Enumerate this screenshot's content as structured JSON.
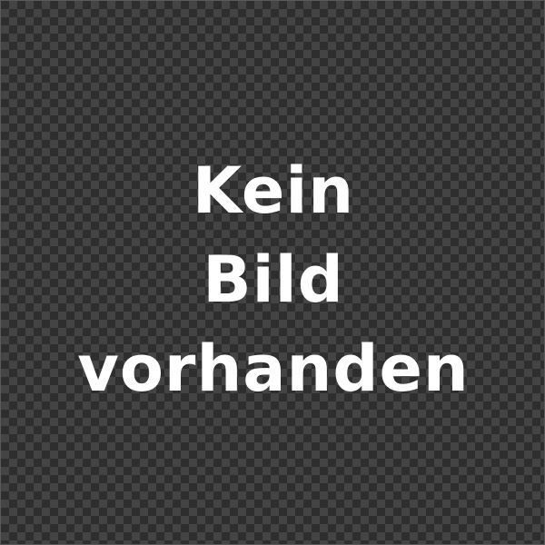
{
  "placeholder": {
    "lines": [
      "Kein",
      "Bild",
      "vorhanden"
    ]
  },
  "colors": {
    "text": "#ffffff",
    "checker_dark": "#2e2e2e",
    "checker_light": "#444444"
  }
}
